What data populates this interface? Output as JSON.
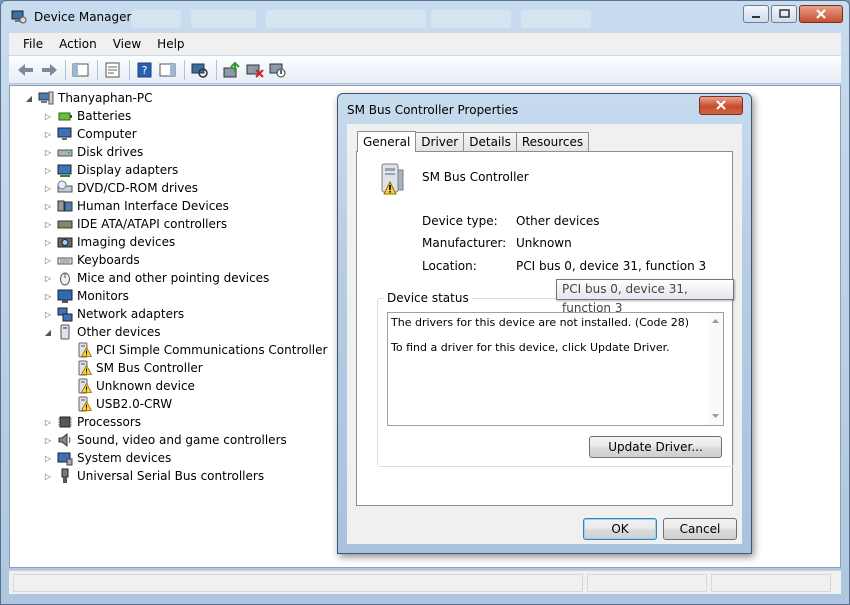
{
  "window": {
    "title": "Device Manager"
  },
  "menu": [
    "File",
    "Action",
    "View",
    "Help"
  ],
  "tree": {
    "root": "Thanyaphan-PC",
    "categories": [
      {
        "label": "Batteries",
        "icon": "battery-icon"
      },
      {
        "label": "Computer",
        "icon": "computer-icon"
      },
      {
        "label": "Disk drives",
        "icon": "disk-drive-icon"
      },
      {
        "label": "Display adapters",
        "icon": "display-adapter-icon"
      },
      {
        "label": "DVD/CD-ROM drives",
        "icon": "dvd-drive-icon"
      },
      {
        "label": "Human Interface Devices",
        "icon": "hid-icon"
      },
      {
        "label": "IDE ATA/ATAPI controllers",
        "icon": "ide-controller-icon"
      },
      {
        "label": "Imaging devices",
        "icon": "camera-icon"
      },
      {
        "label": "Keyboards",
        "icon": "keyboard-icon"
      },
      {
        "label": "Mice and other pointing devices",
        "icon": "mouse-icon"
      },
      {
        "label": "Monitors",
        "icon": "monitor-icon"
      },
      {
        "label": "Network adapters",
        "icon": "network-adapter-icon"
      },
      {
        "label": "Other devices",
        "icon": "other-devices-icon"
      }
    ],
    "other_devices": [
      "PCI Simple Communications Controller",
      "SM Bus Controller",
      "Unknown device",
      "USB2.0-CRW"
    ],
    "after": [
      {
        "label": "Processors",
        "icon": "processor-icon"
      },
      {
        "label": "Sound, video and game controllers",
        "icon": "speaker-icon"
      },
      {
        "label": "System devices",
        "icon": "system-devices-icon"
      },
      {
        "label": "Universal Serial Bus controllers",
        "icon": "usb-icon"
      }
    ]
  },
  "dialog": {
    "title": "SM Bus Controller Properties",
    "tabs": [
      "General",
      "Driver",
      "Details",
      "Resources"
    ],
    "device_name": "SM Bus Controller",
    "props": {
      "type_label": "Device type:",
      "type_value": "Other devices",
      "mfr_label": "Manufacturer:",
      "mfr_value": "Unknown",
      "loc_label": "Location:",
      "loc_value": "PCI bus 0, device 31, function 3"
    },
    "status_group": "Device status",
    "status_lines": [
      "The drivers for this device are not installed. (Code 28)",
      "To find a driver for this device, click Update Driver."
    ],
    "update_button": "Update Driver...",
    "ok": "OK",
    "cancel": "Cancel"
  },
  "tooltip": "PCI bus 0, device 31, function 3"
}
